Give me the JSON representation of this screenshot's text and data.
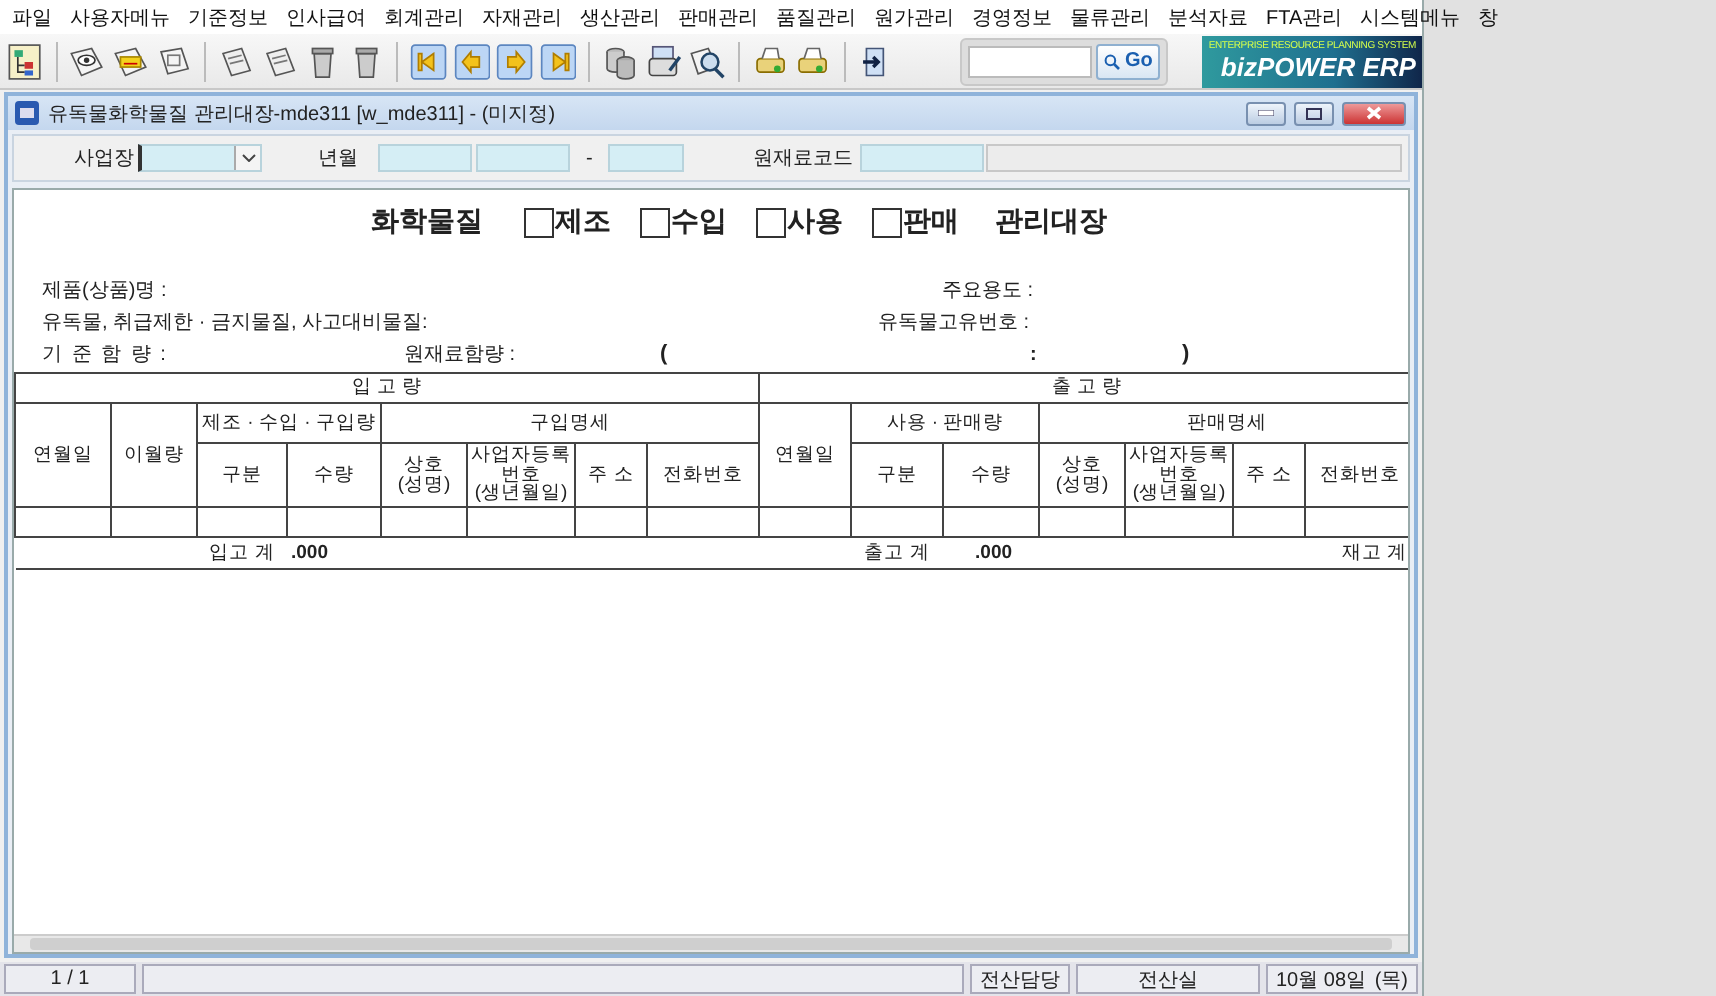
{
  "menu": [
    "파일",
    "사용자메뉴",
    "기준정보",
    "인사급여",
    "회계관리",
    "자재관리",
    "생산관리",
    "판매관리",
    "품질관리",
    "원가관리",
    "경영정보",
    "물류관리",
    "분석자료",
    "FTA관리",
    "시스템메뉴",
    "창"
  ],
  "toolbar": {
    "go_button": "Go",
    "logo": {
      "tagline": "ENTERPRISE RESOURCE PLANNING SYSTEM",
      "name": "bizPOWER ERP"
    }
  },
  "window": {
    "title": "유독물화학물질 관리대장-mde311 [w_mde311] - (미지정)"
  },
  "filters": [
    {
      "kind": "combo",
      "label": "사업장"
    },
    {
      "kind": "range",
      "label": "년월",
      "separator": "-"
    },
    {
      "kind": "code",
      "label": "원재료코드"
    }
  ],
  "report": {
    "title": "화학물질",
    "options": [
      {
        "label": "제조",
        "checked": false
      },
      {
        "label": "수입",
        "checked": false
      },
      {
        "label": "사용",
        "checked": false
      },
      {
        "label": "판매",
        "checked": false
      }
    ],
    "title_suffix": "관리대장",
    "info_rows": [
      {
        "left": "제품(상품)명 :",
        "right": "주요용도 :"
      },
      {
        "left": "유독물, 취급제한 · 금지물질, 사고대비물질:",
        "right": "유독물고유번호 :"
      }
    ],
    "content_row": {
      "label": "기 준 함 량 :",
      "content_label": "원재료함량 :",
      "open": "(",
      "colon": ":",
      "close": ")"
    },
    "inbound": {
      "title": "입 고 량",
      "date_column": "연월일",
      "carryover_column": "이월량",
      "quantity_group": {
        "title": "제조 · 수입 · 구입량",
        "columns": [
          "구분",
          "수량"
        ]
      },
      "detail_group": {
        "title": "구입명세",
        "columns": [
          "상호\n(성명)",
          "사업자등록\n번호\n(생년월일)",
          "주 소",
          "전화번호"
        ]
      },
      "total_label": "입고 계",
      "total_value": ".000"
    },
    "outbound": {
      "title": "출 고 량",
      "date_column": "연월일",
      "quantity_group": {
        "title": "사용 · 판매량",
        "columns": [
          "구분",
          "수량"
        ]
      },
      "detail_group": {
        "title": "판매명세",
        "columns": [
          "상호\n(성명)",
          "사업자등록\n번호\n(생년월일)",
          "주 소",
          "전화번호"
        ]
      },
      "total_label": "출고 계",
      "total_value": ".000"
    },
    "stock_total_label": "재고 계"
  },
  "status_bar": {
    "page": "1 / 1",
    "user": "전산담당",
    "department": "전산실",
    "date": "10월 08일",
    "weekday": "(목)"
  }
}
